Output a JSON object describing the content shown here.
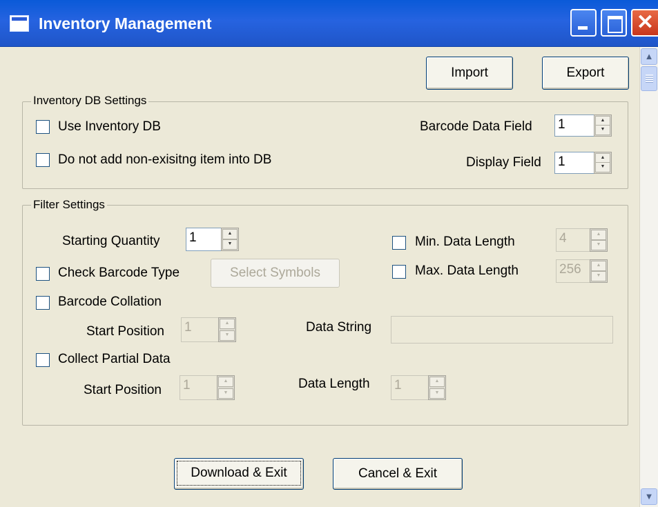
{
  "window": {
    "title": "Inventory Management",
    "minimize_icon": "minimize-icon",
    "maximize_icon": "maximize-icon",
    "close_icon": "close-icon",
    "close_glyph": "✕"
  },
  "toolbar": {
    "import_label": "Import",
    "export_label": "Export"
  },
  "inventory_db": {
    "legend": "Inventory DB Settings",
    "use_db_label": "Use Inventory DB",
    "use_db_checked": false,
    "no_add_label": "Do not add non-exisitng item into DB",
    "no_add_checked": false,
    "barcode_field_label": "Barcode Data Field",
    "barcode_field_value": "1",
    "display_field_label": "Display Field",
    "display_field_value": "1"
  },
  "filter": {
    "legend": "Filter Settings",
    "starting_qty_label": "Starting Quantity",
    "starting_qty_value": "1",
    "check_type_label": "Check Barcode Type",
    "check_type_checked": false,
    "select_symbols_label": "Select Symbols",
    "min_len_label": "Min. Data Length",
    "min_len_checked": false,
    "min_len_value": "4",
    "max_len_label": "Max. Data Length",
    "max_len_checked": false,
    "max_len_value": "256",
    "collation_label": "Barcode Collation",
    "collation_checked": false,
    "collation_start_label": "Start Position",
    "collation_start_value": "1",
    "data_string_label": "Data String",
    "data_string_value": "",
    "partial_label": "Collect Partial Data",
    "partial_checked": false,
    "partial_start_label": "Start Position",
    "partial_start_value": "1",
    "data_length_label": "Data Length",
    "data_length_value": "1"
  },
  "footer": {
    "download_label": "Download & Exit",
    "cancel_label": "Cancel & Exit"
  },
  "colors": {
    "titlebar": "#2663e0",
    "dialog_bg": "#ece9d8",
    "close_button": "#d5462a"
  }
}
